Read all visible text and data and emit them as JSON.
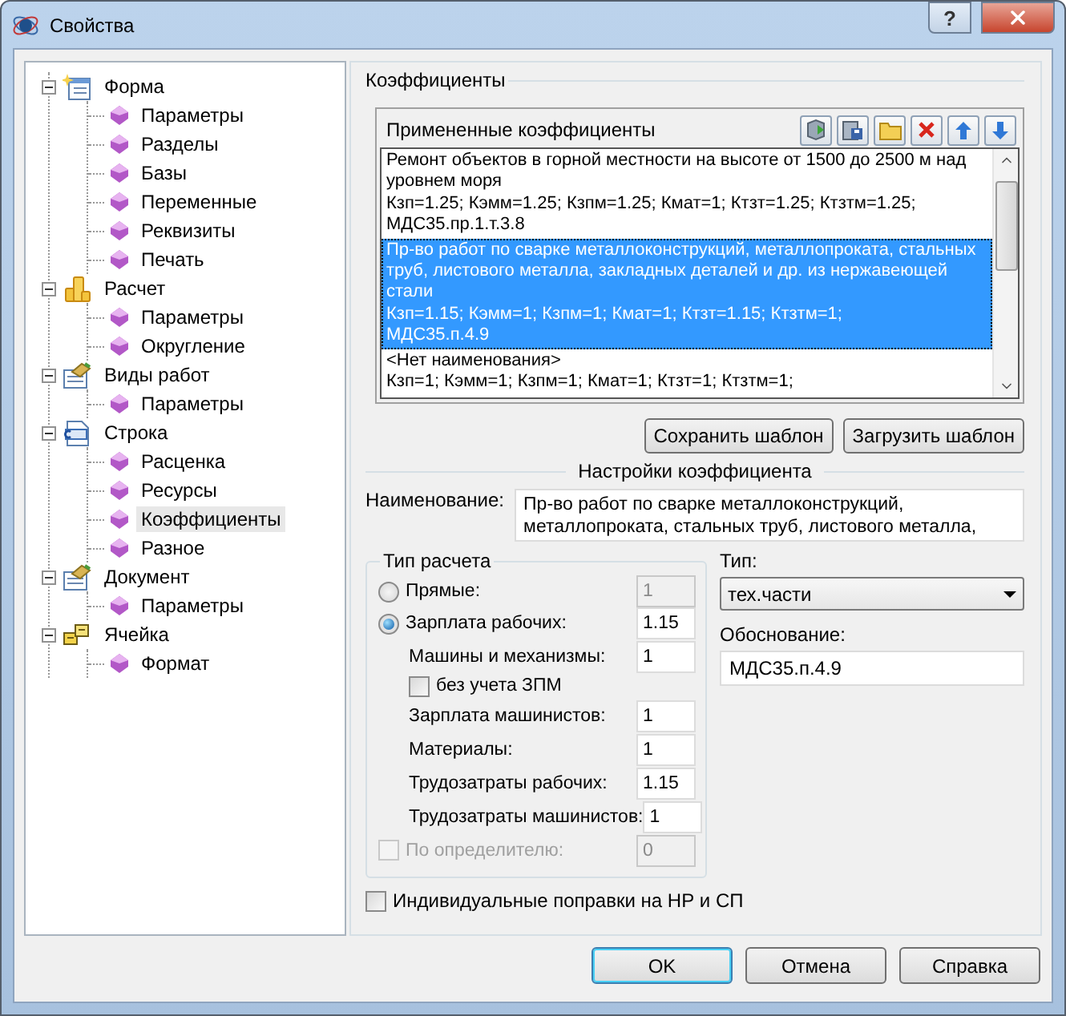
{
  "window": {
    "title": "Свойства",
    "help_glyph": "?"
  },
  "tree": [
    {
      "label": "Форма",
      "kind": "form",
      "expanded": true,
      "children": [
        {
          "label": "Параметры",
          "selected": false
        },
        {
          "label": "Разделы",
          "selected": false
        },
        {
          "label": "Базы",
          "selected": false
        },
        {
          "label": "Переменные",
          "selected": false
        },
        {
          "label": "Реквизиты",
          "selected": false
        },
        {
          "label": "Печать",
          "selected": false
        }
      ]
    },
    {
      "label": "Расчет",
      "kind": "coins",
      "expanded": true,
      "children": [
        {
          "label": "Параметры",
          "selected": false
        },
        {
          "label": "Округление",
          "selected": false
        }
      ]
    },
    {
      "label": "Виды работ",
      "kind": "sheet",
      "expanded": true,
      "children": [
        {
          "label": "Параметры",
          "selected": false
        }
      ]
    },
    {
      "label": "Строка",
      "kind": "row",
      "expanded": true,
      "children": [
        {
          "label": "Расценка",
          "selected": false
        },
        {
          "label": "Ресурсы",
          "selected": false
        },
        {
          "label": "Коэффициенты",
          "selected": true
        },
        {
          "label": "Разное",
          "selected": false
        }
      ]
    },
    {
      "label": "Документ",
      "kind": "sheet",
      "expanded": true,
      "children": [
        {
          "label": "Параметры",
          "selected": false
        }
      ]
    },
    {
      "label": "Ячейка",
      "kind": "cell",
      "expanded": true,
      "children": [
        {
          "label": "Формат",
          "selected": false
        }
      ]
    }
  ],
  "coefficients": {
    "title": "Коэффициенты",
    "list_header": "Примененные коэффициенты",
    "items": [
      {
        "lines": [
          "Ремонт объектов в горной местности на высоте от 1500 до 2500 м над",
          "уровнем моря",
          "Кзп=1.25; Кэмм=1.25; Кзпм=1.25; Кмат=1; Ктзт=1.25; Ктзтм=1.25;",
          "МДС35.пр.1.т.3.8"
        ],
        "selected": false
      },
      {
        "lines": [
          "Пр-во работ по сварке металлоконструкций, металлопроката, стальных",
          "труб, листового металла, закладных деталей и др. из нержавеющей",
          "стали",
          "Кзп=1.15; Кэмм=1; Кзпм=1; Кмат=1; Ктзт=1.15; Ктзтм=1;",
          "МДС35.п.4.9"
        ],
        "selected": true
      },
      {
        "lines": [
          "<Нет наименования>",
          "Кзп=1; Кэмм=1; Кзпм=1; Кмат=1; Ктзт=1; Ктзтм=1;"
        ],
        "selected": false
      }
    ],
    "template_buttons": [
      "Сохранить шаблон",
      "Загрузить шаблон"
    ]
  },
  "settings": {
    "title": "Настройки коэффициента",
    "name_label": "Наименование:",
    "name_lines": [
      "Пр-во работ по сварке металлоконструкций,",
      "металлопроката, стальных труб, листового металла,"
    ],
    "calc_type": {
      "title": "Тип расчета",
      "rows": [
        {
          "kind": "radio",
          "label": "Прямые:",
          "selected": false,
          "value": "1",
          "disabled": true
        },
        {
          "kind": "radio",
          "label": "Зарплата рабочих:",
          "selected": true,
          "value": "1.15",
          "disabled": false
        },
        {
          "kind": "field",
          "label": "Машины и механизмы:",
          "value": "1",
          "disabled": false
        },
        {
          "kind": "checkbox",
          "label": "без учета ЗПМ",
          "checked": false,
          "disabled": false
        },
        {
          "kind": "field",
          "label": "Зарплата машинистов:",
          "value": "1",
          "disabled": false
        },
        {
          "kind": "field",
          "label": "Материалы:",
          "value": "1",
          "disabled": false
        },
        {
          "kind": "field",
          "label": "Трудозатраты рабочих:",
          "value": "1.15",
          "disabled": false
        },
        {
          "kind": "field",
          "label": "Трудозатраты машинистов:",
          "value": "1",
          "disabled": false
        },
        {
          "kind": "checkbox-field",
          "label": "По определителю:",
          "checked": false,
          "value": "0",
          "disabled": true
        }
      ]
    },
    "type_label": "Тип:",
    "type_value": "тех.части",
    "basis_label": "Обоснование:",
    "basis_value": "МДС35.п.4.9",
    "individual": {
      "label": "Индивидуальные поправки на НР и СП",
      "checked": false
    }
  },
  "buttons": [
    {
      "label": "OK",
      "default": true
    },
    {
      "label": "Отмена",
      "default": false
    },
    {
      "label": "Справка",
      "default": false
    }
  ]
}
